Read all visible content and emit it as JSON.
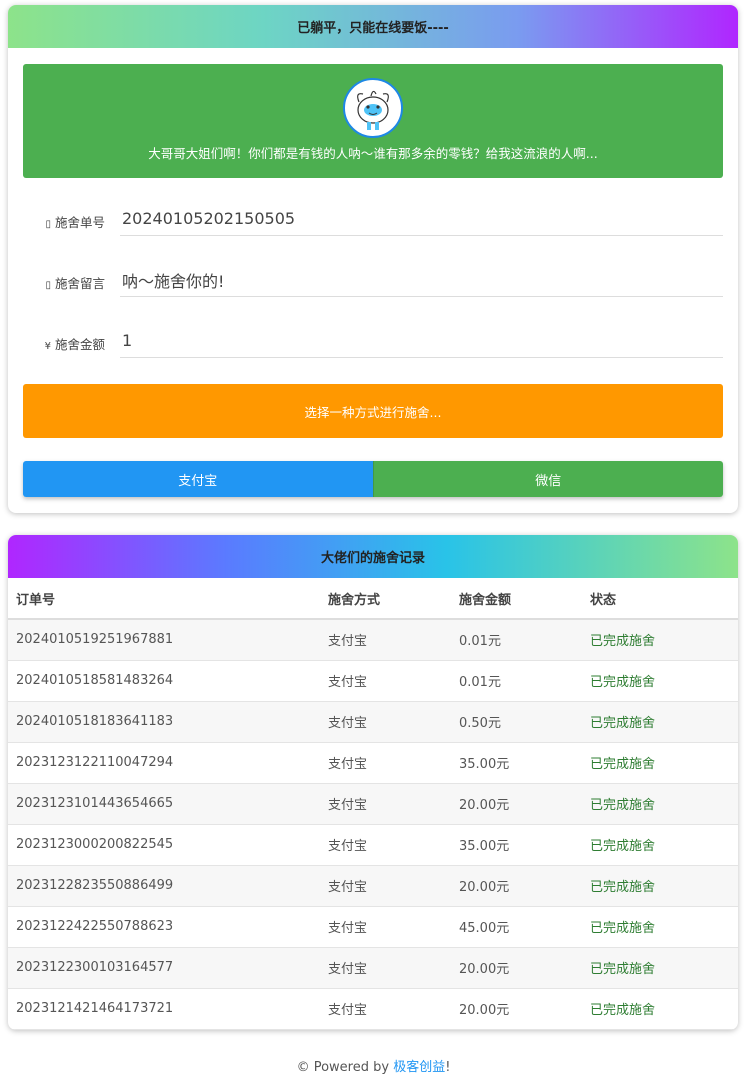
{
  "top_card": {
    "title": "已躺平，只能在线要饭----",
    "banner_text": "大哥哥大姐们啊！你们都是有钱的人呐～谁有那多余的零钱？给我这流浪的人啊...",
    "fields": [
      {
        "icon": "▯",
        "label": "施舍单号",
        "value": "20240105202150505"
      },
      {
        "icon": "▯",
        "label": "施舍留言",
        "value": "呐～施舍你的!"
      },
      {
        "icon": "¥",
        "label": "施舍金额",
        "value": "1"
      }
    ],
    "select_text": "选择一种方式进行施舍...",
    "pay_alipay": "支付宝",
    "pay_wechat": "微信"
  },
  "records": {
    "title": "大佬们的施舍记录",
    "columns": [
      "订单号",
      "施舍方式",
      "施舍金额",
      "状态"
    ],
    "rows": [
      [
        "2024010519251967881",
        "支付宝",
        "0.01元",
        "已完成施舍"
      ],
      [
        "2024010518581483264",
        "支付宝",
        "0.01元",
        "已完成施舍"
      ],
      [
        "2024010518183641183",
        "支付宝",
        "0.50元",
        "已完成施舍"
      ],
      [
        "2023123122110047294",
        "支付宝",
        "35.00元",
        "已完成施舍"
      ],
      [
        "2023123101443654665",
        "支付宝",
        "20.00元",
        "已完成施舍"
      ],
      [
        "2023123000200822545",
        "支付宝",
        "35.00元",
        "已完成施舍"
      ],
      [
        "2023122823550886499",
        "支付宝",
        "20.00元",
        "已完成施舍"
      ],
      [
        "2023122422550788623",
        "支付宝",
        "45.00元",
        "已完成施舍"
      ],
      [
        "2023122300103164577",
        "支付宝",
        "20.00元",
        "已完成施舍"
      ],
      [
        "2023121421464173721",
        "支付宝",
        "20.00元",
        "已完成施舍"
      ]
    ]
  },
  "footer": {
    "prefix": "© Powered by ",
    "link": "极客创益",
    "suffix": "!"
  },
  "colors": {
    "banner": "#4caf50",
    "select_bar": "#ff9800",
    "alipay": "#2196f3",
    "wechat": "#4caf50",
    "status": "#2e7d32"
  },
  "icons": {
    "avatar": "cartoon-avatar-icon",
    "order": "document-icon",
    "message": "message-icon",
    "amount": "yuan-icon"
  }
}
